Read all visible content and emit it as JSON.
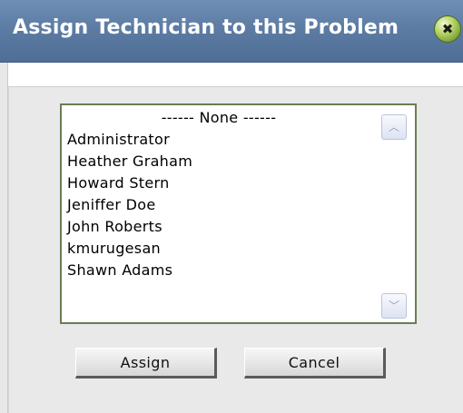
{
  "dialog": {
    "title": "Assign Technician to this Problem",
    "close_icon_glyph": "✖",
    "close_icon": "close-icon"
  },
  "technicians": {
    "options": [
      "------ None ------",
      "Administrator",
      "Heather Graham",
      "Howard Stern",
      "Jeniffer Doe",
      "John Roberts",
      "kmurugesan",
      "Shawn Adams"
    ],
    "scroll_up_icon": "chevron-up-icon",
    "scroll_down_icon": "chevron-down-icon",
    "scroll_up_glyph": "︿",
    "scroll_down_glyph": "﹀"
  },
  "actions": {
    "assign_label": "Assign",
    "cancel_label": "Cancel"
  },
  "colors": {
    "titlebar": "#5d7ca4",
    "panel": "#e9e9e9",
    "listbox_border": "#6b7d53",
    "close_button": "#9fc54f"
  }
}
